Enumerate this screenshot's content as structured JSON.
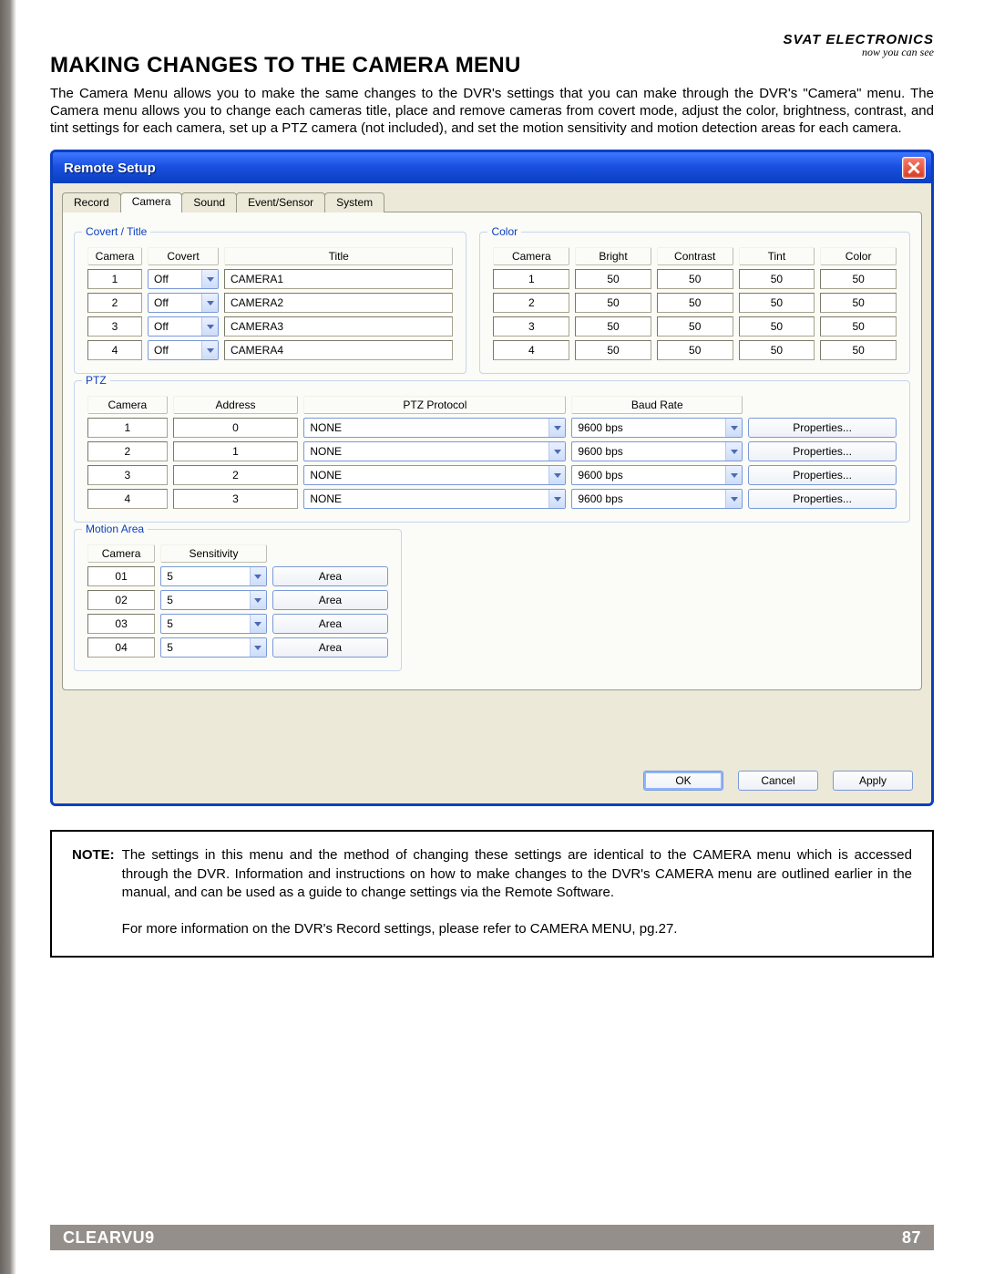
{
  "brand": {
    "name": "SVAT ELECTRONICS",
    "tagline": "now you can see"
  },
  "section_title": "MAKING CHANGES TO THE CAMERA MENU",
  "intro": "The Camera Menu allows you to make the same changes to the DVR's settings that you can make through the DVR's \"Camera\" menu.  The Camera menu allows you to change each cameras title, place and remove cameras from covert mode, adjust the color, brightness, contrast, and tint settings for each camera, set up a PTZ camera (not included), and set the motion sensitivity and motion detection areas for each camera.",
  "window": {
    "title": "Remote Setup",
    "tabs": [
      "Record",
      "Camera",
      "Sound",
      "Event/Sensor",
      "System"
    ],
    "active_tab_index": 1,
    "covert": {
      "legend": "Covert / Title",
      "headers": [
        "Camera",
        "Covert",
        "Title"
      ],
      "rows": [
        {
          "cam": "1",
          "covert": "Off",
          "title": "CAMERA1"
        },
        {
          "cam": "2",
          "covert": "Off",
          "title": "CAMERA2"
        },
        {
          "cam": "3",
          "covert": "Off",
          "title": "CAMERA3"
        },
        {
          "cam": "4",
          "covert": "Off",
          "title": "CAMERA4"
        }
      ]
    },
    "color": {
      "legend": "Color",
      "headers": [
        "Camera",
        "Bright",
        "Contrast",
        "Tint",
        "Color"
      ],
      "rows": [
        {
          "cam": "1",
          "bright": "50",
          "contrast": "50",
          "tint": "50",
          "color": "50"
        },
        {
          "cam": "2",
          "bright": "50",
          "contrast": "50",
          "tint": "50",
          "color": "50"
        },
        {
          "cam": "3",
          "bright": "50",
          "contrast": "50",
          "tint": "50",
          "color": "50"
        },
        {
          "cam": "4",
          "bright": "50",
          "contrast": "50",
          "tint": "50",
          "color": "50"
        }
      ]
    },
    "ptz": {
      "legend": "PTZ",
      "headers": [
        "Camera",
        "Address",
        "PTZ Protocol",
        "Baud Rate",
        ""
      ],
      "props_label": "Properties...",
      "rows": [
        {
          "cam": "1",
          "addr": "0",
          "proto": "NONE",
          "baud": "9600 bps"
        },
        {
          "cam": "2",
          "addr": "1",
          "proto": "NONE",
          "baud": "9600 bps"
        },
        {
          "cam": "3",
          "addr": "2",
          "proto": "NONE",
          "baud": "9600 bps"
        },
        {
          "cam": "4",
          "addr": "3",
          "proto": "NONE",
          "baud": "9600 bps"
        }
      ]
    },
    "motion": {
      "legend": "Motion Area",
      "headers": [
        "Camera",
        "Sensitivity",
        ""
      ],
      "area_label": "Area",
      "rows": [
        {
          "cam": "01",
          "sens": "5"
        },
        {
          "cam": "02",
          "sens": "5"
        },
        {
          "cam": "03",
          "sens": "5"
        },
        {
          "cam": "04",
          "sens": "5"
        }
      ]
    },
    "buttons": {
      "ok": "OK",
      "cancel": "Cancel",
      "apply": "Apply"
    }
  },
  "note": {
    "label": "NOTE:",
    "body": "The settings in this menu and the method of changing these settings are identical to the CAMERA menu which is accessed through the DVR.  Information and instructions on how to make changes to the DVR's CAMERA menu are outlined earlier in the manual, and can be used as a guide to change settings via the Remote Software.",
    "more": "For more information on the DVR's Record settings, please refer to CAMERA MENU, pg.27."
  },
  "footer": {
    "product": "CLEARVU9",
    "page": "87"
  }
}
